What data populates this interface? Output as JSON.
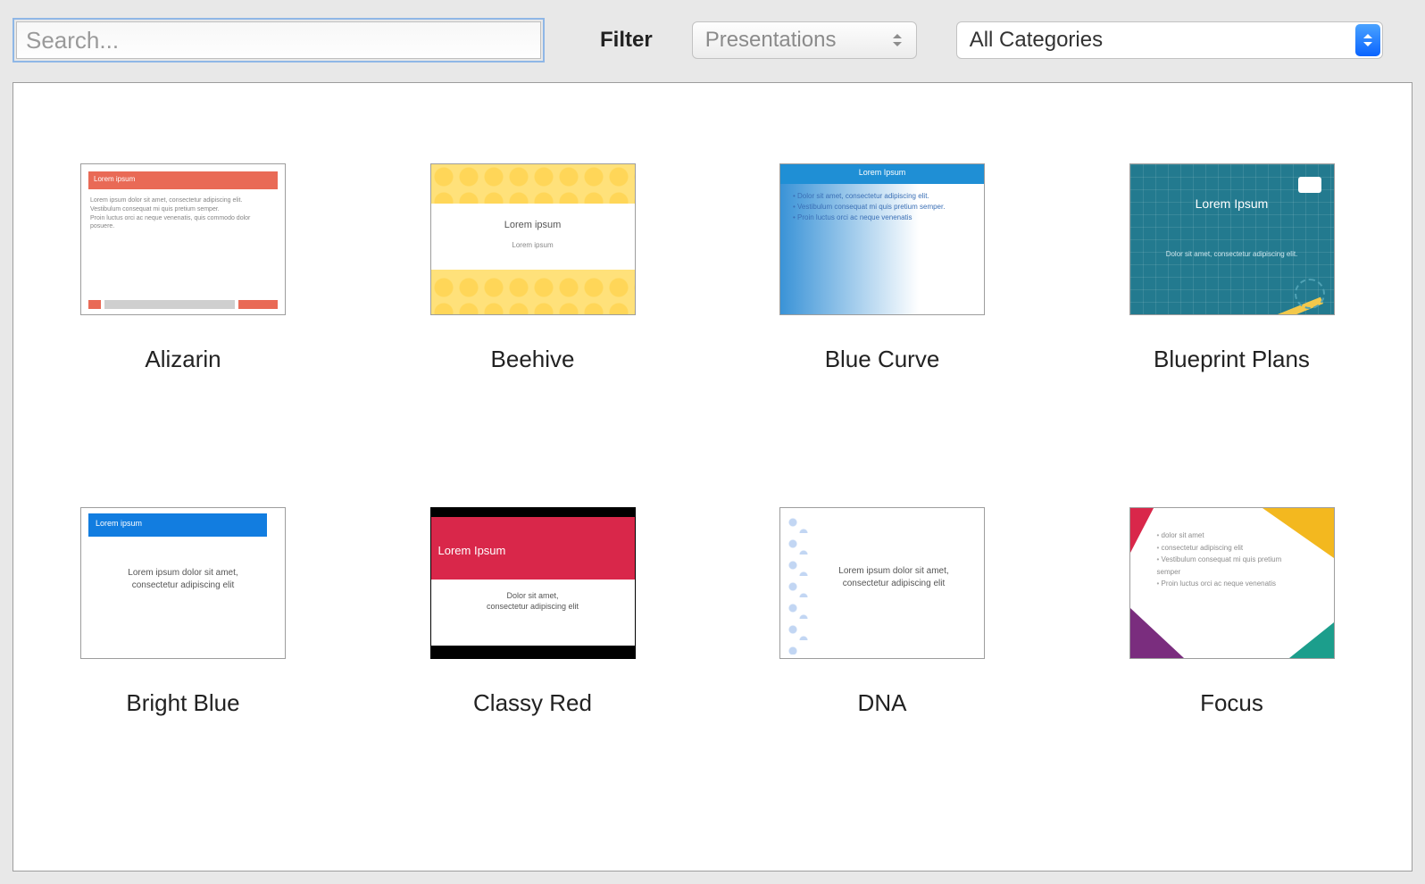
{
  "toolbar": {
    "search_placeholder": "Search...",
    "search_value": "",
    "filter_label": "Filter",
    "filter_type_selected": "Presentations",
    "filter_category_selected": "All Categories"
  },
  "lorem": {
    "title": "Lorem ipsum",
    "title_caps": "Lorem Ipsum",
    "line_a": "Lorem ipsum dolor sit amet, consectetur adipiscing elit.",
    "line_b": "Vestibulum consequat mi quis pretium semper.",
    "line_c": "Proin luctus orci ac neque venenatis, quis commodo dolor",
    "line_d": "posuere.",
    "short_a": "Dolor sit amet, consectetur adipiscing elit.",
    "short_b": "Lorem ipsum dolor sit amet,",
    "short_c": "consectetur adipiscing elit",
    "short_d": "Dolor sit amet,",
    "bullet_a": "dolor sit amet",
    "bullet_b": "consectetur adipiscing elit",
    "bullet_c": "Vestibulum consequat mi quis pretium semper",
    "bullet_d": "Proin luctus orci ac neque venenatis"
  },
  "templates": [
    {
      "id": "alizarin",
      "label": "Alizarin"
    },
    {
      "id": "beehive",
      "label": "Beehive"
    },
    {
      "id": "bluecurve",
      "label": "Blue Curve"
    },
    {
      "id": "blueprint",
      "label": "Blueprint Plans"
    },
    {
      "id": "brightblue",
      "label": "Bright Blue"
    },
    {
      "id": "classyred",
      "label": "Classy Red"
    },
    {
      "id": "dna",
      "label": "DNA"
    },
    {
      "id": "focus",
      "label": "Focus"
    }
  ]
}
